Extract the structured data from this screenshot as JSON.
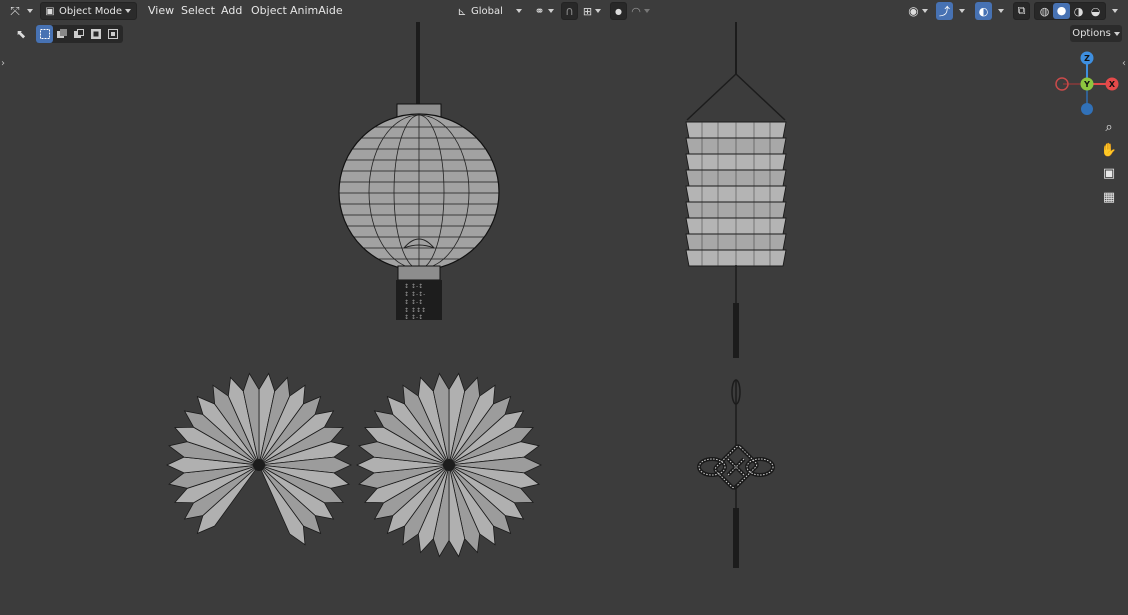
{
  "header": {
    "editor_type_icon": "view3d-icon",
    "mode": {
      "icon": "object-mode-icon",
      "label": "Object Mode"
    },
    "menus": [
      "View",
      "Select",
      "Add",
      "Object",
      "AnimAide"
    ],
    "transform_orientation": {
      "icon": "orientation-icon",
      "label": "Global"
    },
    "pivot_icon": "link-icon",
    "snap_icon": "magnet-icon",
    "snap_target_icon": "snap-increment-icon",
    "proportional_icon": "proportional-dot-icon",
    "falloff_icon": "falloff-curve-icon",
    "visibility_icon": "eye-icon",
    "gizmo_icon": "gizmo-icon",
    "overlay_icon": "overlay-icon",
    "xray_icon": "xray-icon",
    "shading_modes": [
      "wireframe-icon",
      "solid-icon",
      "material-icon",
      "rendered-icon"
    ],
    "active_shading": "solid-icon"
  },
  "tool_header": {
    "tool_icon": "select-cursor-icon",
    "select_modes": [
      "select-new-icon",
      "select-extend-icon",
      "select-subtract-icon",
      "select-invert-icon",
      "select-intersect-icon"
    ],
    "options_label": "Options"
  },
  "navigation": {
    "gizmo_axes": {
      "z": "Z",
      "y": "Y",
      "x": "X"
    },
    "axis_colors": {
      "x": "#e44a4a",
      "y": "#8dc63f",
      "z": "#3e8fe0"
    },
    "buttons": [
      "zoom-icon",
      "pan-hand-icon",
      "camera-icon",
      "grid-ortho-icon"
    ]
  },
  "scene": {
    "objects": [
      "round-lantern",
      "cylinder-lantern",
      "paper-fan-left",
      "paper-fan-right",
      "chinese-knot"
    ]
  },
  "colors": {
    "viewport_bg": "#3c3c3c",
    "header_bg": "#2b2b2b",
    "accent": "#4772b3",
    "mesh_fill": "#9a9a9a",
    "wire": "#111111"
  }
}
